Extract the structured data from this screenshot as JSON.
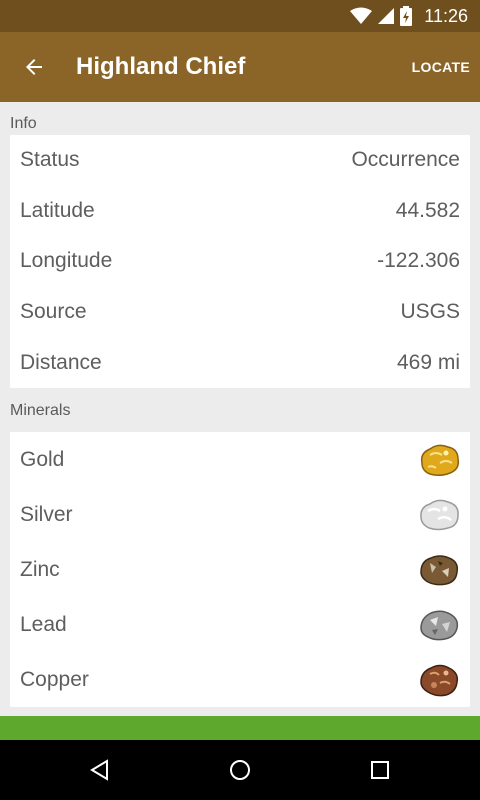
{
  "status_bar": {
    "time": "11:26",
    "icons": [
      "wifi-icon",
      "signal-icon",
      "battery-icon"
    ]
  },
  "app_bar": {
    "title": "Highland Chief",
    "action_label": "LOCATE",
    "back_icon": "arrow-back-icon"
  },
  "info": {
    "header": "Info",
    "rows": [
      {
        "label": "Status",
        "value": "Occurrence"
      },
      {
        "label": "Latitude",
        "value": "44.582"
      },
      {
        "label": "Longitude",
        "value": "-122.306"
      },
      {
        "label": "Source",
        "value": "USGS"
      },
      {
        "label": "Distance",
        "value": "469 mi"
      }
    ]
  },
  "minerals": {
    "header": "Minerals",
    "items": [
      {
        "name": "Gold",
        "icon": "gold-nugget-icon",
        "color": "#e0a91c"
      },
      {
        "name": "Silver",
        "icon": "silver-nugget-icon",
        "color": "#d8d8d8"
      },
      {
        "name": "Zinc",
        "icon": "zinc-ore-icon",
        "color": "#7a5a35"
      },
      {
        "name": "Lead",
        "icon": "lead-ore-icon",
        "color": "#9a9a9a"
      },
      {
        "name": "Copper",
        "icon": "copper-ore-icon",
        "color": "#8a4a2a"
      }
    ]
  },
  "colors": {
    "status_bar": "#6e4f1d",
    "app_bar": "#8b6428",
    "bottom_accent": "#5fa82e",
    "background": "#ececec"
  },
  "nav_bar": {
    "icons": [
      "back-triangle-icon",
      "home-circle-icon",
      "recents-square-icon"
    ]
  }
}
